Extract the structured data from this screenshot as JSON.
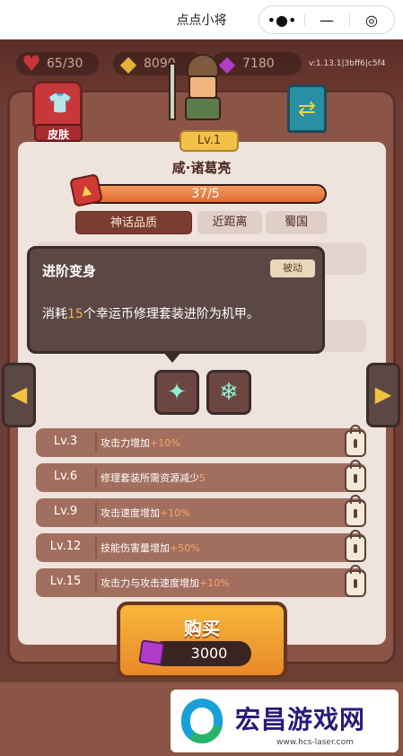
{
  "navbar": {
    "title": "点点小将",
    "more_icon": "•●•",
    "minimize_icon": "—",
    "close_icon": "◎"
  },
  "resources": {
    "hearts": "65/30",
    "coins": "8090",
    "gems": "7180"
  },
  "version": "v:1.13.1|3bff6|c5f4",
  "skin_button": {
    "label": "皮肤"
  },
  "hero": {
    "level": "Lv.1",
    "name": "咸·诸葛亮",
    "exp_text": "37/5",
    "exp_progress": 1.0
  },
  "tags": [
    "神话品质",
    "近距离",
    "蜀国"
  ],
  "tooltip": {
    "title": "进阶变身",
    "badge": "被动",
    "desc_prefix": "消耗",
    "desc_number": "15",
    "desc_suffix": "个幸运币修理套装进阶为机甲。"
  },
  "levels": [
    {
      "lv": "Lv.3",
      "text": "攻击力增加",
      "value": "+10%"
    },
    {
      "lv": "Lv.6",
      "text": "修理套装所需资源减少",
      "value": "5"
    },
    {
      "lv": "Lv.9",
      "text": "攻击速度增加",
      "value": "+10%"
    },
    {
      "lv": "Lv.12",
      "text": "技能伤害量增加",
      "value": "+50%"
    },
    {
      "lv": "Lv.15",
      "text": "攻击力与攻击速度增加",
      "value": "+10%"
    }
  ],
  "buy": {
    "label": "购买",
    "price": "3000"
  },
  "watermark": {
    "text": "宏昌游戏网",
    "url": "www.hcs-laser.com"
  },
  "colors": {
    "accent": "#f2c14a",
    "exp_fill": "#e06e33",
    "highlight": "#f6b04d",
    "panel": "#8a5446"
  },
  "icons": {
    "heart": "heart-icon",
    "coin": "coin-icon",
    "gem": "gem-icon",
    "skin": "shirt-icon",
    "swap": "swap-icon",
    "lock": "lock-icon"
  }
}
